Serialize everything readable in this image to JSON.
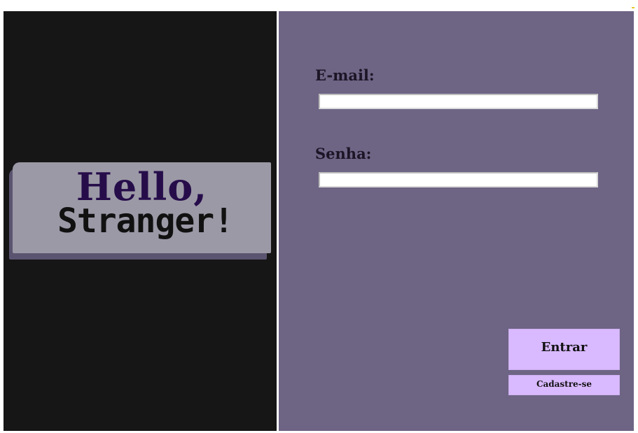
{
  "logo": {
    "line1": "Hello,",
    "line2": "Stranger!"
  },
  "form": {
    "email_label": "E-mail:",
    "email_value": "",
    "password_label": "Senha:",
    "password_value": ""
  },
  "buttons": {
    "login_label": "Entrar",
    "register_label": "Cadastre-se"
  },
  "colors": {
    "left_panel": "#161616",
    "right_panel": "#6e6484",
    "button_bg": "#d9b9ff",
    "logo_card": "#9b99a6",
    "logo_hello": "#260d4a"
  }
}
